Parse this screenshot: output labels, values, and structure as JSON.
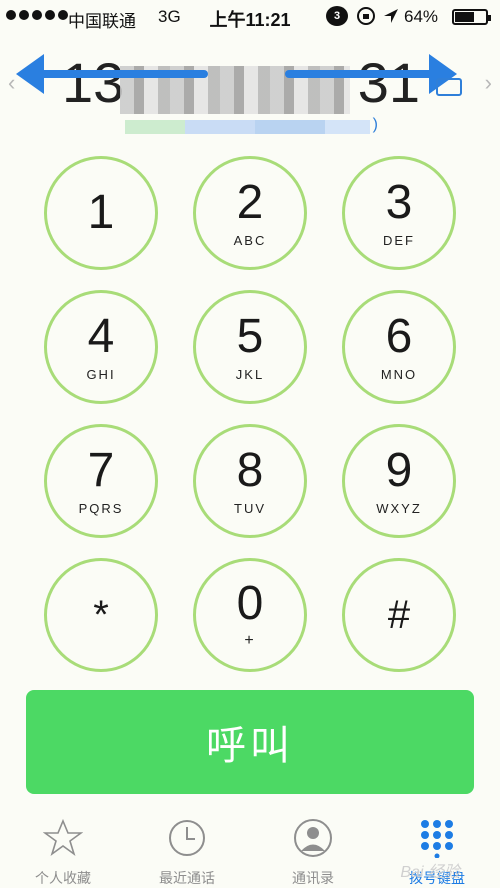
{
  "status_bar": {
    "carrier": "中国联通",
    "network": "3G",
    "time": "上午11:21",
    "notification_count": "3",
    "battery_percent": "64%",
    "battery_level": 0.64
  },
  "display": {
    "number_head": "13",
    "number_tail": "31"
  },
  "keypad": [
    {
      "digit": "1",
      "letters": ""
    },
    {
      "digit": "2",
      "letters": "ABC"
    },
    {
      "digit": "3",
      "letters": "DEF"
    },
    {
      "digit": "4",
      "letters": "GHI"
    },
    {
      "digit": "5",
      "letters": "JKL"
    },
    {
      "digit": "6",
      "letters": "MNO"
    },
    {
      "digit": "7",
      "letters": "PQRS"
    },
    {
      "digit": "8",
      "letters": "TUV"
    },
    {
      "digit": "9",
      "letters": "WXYZ"
    },
    {
      "digit": "*",
      "letters": ""
    },
    {
      "digit": "0",
      "letters": "+"
    },
    {
      "digit": "#",
      "letters": ""
    }
  ],
  "call_label": "呼叫",
  "tabs": [
    {
      "label": "个人收藏",
      "icon": "star-icon",
      "active": false
    },
    {
      "label": "最近通话",
      "icon": "clock-icon",
      "active": false
    },
    {
      "label": "通讯录",
      "icon": "contacts-icon",
      "active": false
    },
    {
      "label": "拨号键盘",
      "icon": "keypad-icon",
      "active": true
    }
  ],
  "colors": {
    "accent": "#1d7ce4",
    "call_green": "#4cd964",
    "key_ring": "#a8dc78"
  }
}
